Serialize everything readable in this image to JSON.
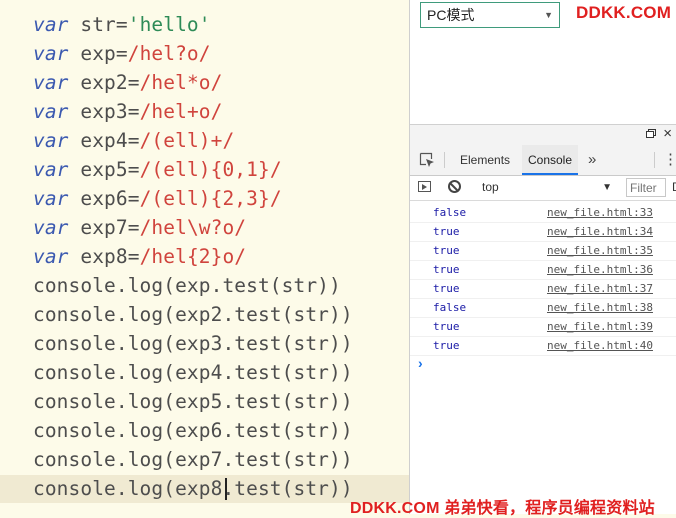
{
  "editor": {
    "lines": [
      [
        [
          "kw",
          "var"
        ],
        [
          "pl",
          " str="
        ],
        [
          "str",
          "'hello'"
        ]
      ],
      [
        [
          "kw",
          "var"
        ],
        [
          "pl",
          " exp="
        ],
        [
          "rx",
          "/hel?o/"
        ]
      ],
      [
        [
          "kw",
          "var"
        ],
        [
          "pl",
          " exp2="
        ],
        [
          "rx",
          "/hel*o/"
        ]
      ],
      [
        [
          "kw",
          "var"
        ],
        [
          "pl",
          " exp3="
        ],
        [
          "rx",
          "/hel+o/"
        ]
      ],
      [
        [
          "kw",
          "var"
        ],
        [
          "pl",
          " exp4="
        ],
        [
          "rx",
          "/(ell)+/"
        ]
      ],
      [
        [
          "kw",
          "var"
        ],
        [
          "pl",
          " exp5="
        ],
        [
          "rx",
          "/(ell){0,1}/"
        ]
      ],
      [
        [
          "kw",
          "var"
        ],
        [
          "pl",
          " exp6="
        ],
        [
          "rx",
          "/(ell){2,3}/"
        ]
      ],
      [
        [
          "kw",
          "var"
        ],
        [
          "pl",
          " exp7="
        ],
        [
          "rx",
          "/hel\\w?o/"
        ]
      ],
      [
        [
          "kw",
          "var"
        ],
        [
          "pl",
          " exp8="
        ],
        [
          "rx",
          "/hel{2}o/"
        ]
      ],
      [
        [
          "pl",
          "console.log(exp.test(str))"
        ]
      ],
      [
        [
          "pl",
          "console.log(exp2.test(str))"
        ]
      ],
      [
        [
          "pl",
          "console.log(exp3.test(str))"
        ]
      ],
      [
        [
          "pl",
          "console.log(exp4.test(str))"
        ]
      ],
      [
        [
          "pl",
          "console.log(exp5.test(str))"
        ]
      ],
      [
        [
          "pl",
          "console.log(exp6.test(str))"
        ]
      ],
      [
        [
          "pl",
          "console.log(exp7.test(str))"
        ]
      ],
      [
        [
          "pl",
          "console.log(exp8.test(str))"
        ]
      ]
    ]
  },
  "viewport": {
    "device_label": "PC模式",
    "brand": "DDKK.COM"
  },
  "devtools": {
    "tabs": {
      "elements": "Elements",
      "console": "Console",
      "more": "»"
    },
    "context": "top",
    "filter_placeholder": "Filter",
    "default_levels": "D"
  },
  "console": {
    "entries": [
      {
        "value": "false",
        "source": "new_file.html:33"
      },
      {
        "value": "true",
        "source": "new_file.html:34"
      },
      {
        "value": "true",
        "source": "new_file.html:35"
      },
      {
        "value": "true",
        "source": "new_file.html:36"
      },
      {
        "value": "true",
        "source": "new_file.html:37"
      },
      {
        "value": "false",
        "source": "new_file.html:38"
      },
      {
        "value": "true",
        "source": "new_file.html:39"
      },
      {
        "value": "true",
        "source": "new_file.html:40"
      }
    ],
    "prompt": "›"
  },
  "watermark": "DDKK.COM 弟弟快看，程序员编程资料站",
  "colors": {
    "editor_bg": "#fdfbe9",
    "keyword": "#3b59b0",
    "string": "#2e8b57",
    "regex": "#d0443d",
    "console_value": "#1a1aa6",
    "brand_red": "#e02020",
    "device_border": "#3f9b7c"
  }
}
